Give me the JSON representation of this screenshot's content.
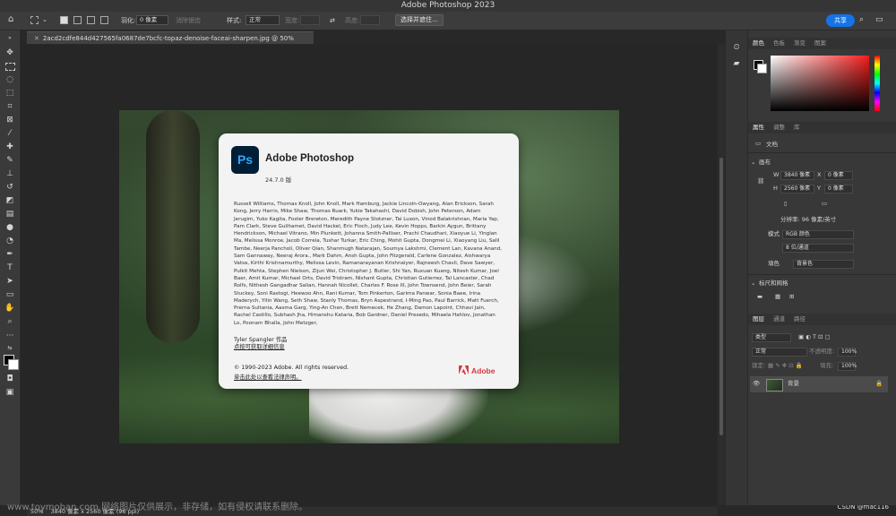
{
  "app": {
    "title": "Adobe Photoshop 2023"
  },
  "options_bar": {
    "feather_label": "羽化:",
    "feather_value": "0 像素",
    "antialias_label": "消除锯齿",
    "style_label": "样式:",
    "style_value": "正常",
    "width_label": "宽度:",
    "height_label": "高度:",
    "select_subject_label": "选择并遮住...",
    "share_label": "共享"
  },
  "document": {
    "tab_title": "2acd2cdfe844d427565fa0687de7bcfc-topaz-denoise-faceai-sharpen.jpg @ 50%(RGB/8#)",
    "zoom": "50%",
    "size_info": "3840 像素 x 2560 像素 (96 ppi)"
  },
  "about": {
    "app_name": "Adobe Photoshop",
    "logo_text": "Ps",
    "version": "24.7.0 版",
    "credits": "Russell Williams, Thomas Knoll, John Knoll, Mark Hamburg, Jackie Lincoln-Owyang, Alan Erickson, Sarah Kong, Jerry Harris, Mike Shaw, Thomas Ruark, Yukie Takahashi, David Dobish, John Peterson, Adam Jerugim, Yuko Kagita, Foster Brereton, Meredith Payne Stotzner, Tai Luxon, Vinod Balakrishnan, Maria Yap, Pam Clark, Steve Guilhamet, David Hackel, Eric Floch, Judy Lee, Kevin Hopps, Barkin Aygun, Brittany Hendrickson, Michael Vitrano, Min Plunkett, Johanna Smith-Palliser, Prachi Chaudhari, Xiaoyue Li, Yinglan Ma, Melissa Monroe, Jacob Correia, Tushar Turkar, Eric Ching, Mohit Gupta, Dongmei Li, Xiaoyang Liu, Salil Tambe, Neerja Pancholi, Oliver Qian, Shanmugh Natarajan, Soumya Lakshmi, Clement Lan, Kavana Anand, Sam Gannaway, Neeraj Arora., Mark Dahm, Ansh Gupta, John Fitzgerald, Carlene Gonzalez, Aishwarya Vatsa, Kirthi Krishnamurthy, Melissa Levin, Ramanarayanan Krishnaiyer, Rajneesh Chavli, Dave Sawyer, Pulkit Mehta, Stephen Nielson, Zijun Wei, Christopher J. Butler, Shi Yan, Ruxuan Kuang, Nitesh Kumar, Joel Baer, Amit Kumar, Michael Orts, David Tristram, Nishant Gupta, Christian Gutierrez, Tal Lancaster, Chad Rolfs, Nithesh Gangadhar Salian, Hannah Nicollet, Charles F. Rose III, John Townsend, John Beier, Sarah Stuckey, Soni Rastogi, Heewoo Ahn, Rani Kumar, Tom Pinkerton, Garima Panwar, Sonia Baee, Irina Maderych, Yilin Wang, Seth Shaw, Stanly Thomas, Bryn Aspestrand, I-Ming Pao, Paul Barrick, Matt Fuerch, Prerna Sultania, Aasma Garg, Ying-An Chen, Brett Nemecek, He Zhang, Damon Lapoint, Chhavi Jain, Rachel Castillo, Subhash Jha, Himanshu Kataria, Bob Gardner, Daniel Presedo, Mihaela Hahlov, Jonathan Lo, Poonam Bhalla, John Metzger,",
    "author": "Tyler Spangler 作品",
    "author_link": "点按可获取详细信息",
    "copyright": "© 1990-2023 Adobe. All rights reserved.",
    "legal_link": "单击此处以查看法律声明。",
    "brand": "Adobe"
  },
  "panels": {
    "color_tabs": [
      "颜色",
      "色板",
      "渐变",
      "图案"
    ],
    "props_tabs": [
      "属性",
      "调整",
      "库"
    ],
    "doc_label": "文档",
    "canvas_label": "画布",
    "w_label": "W",
    "w_value": "3840 像素",
    "h_label": "H",
    "h_value": "2560 像素",
    "x_label": "X",
    "x_placeholder": "0 像素",
    "y_label": "Y",
    "y_placeholder": "0 像素",
    "resolution": "分辨率: 96 像素/英寸",
    "mode_label": "模式",
    "mode_value": "RGB 颜色",
    "depth_value": "8 位/通道",
    "fill_label": "填色",
    "fill_value": "背景色",
    "rulers_label": "标尺和网格",
    "layers_tabs": [
      "图层",
      "通道",
      "路径"
    ],
    "kind_filter": "类型",
    "blend_mode": "正常",
    "opacity_label": "不透明度:",
    "opacity_value": "100%",
    "lock_label": "锁定:",
    "fill_pct_label": "填充:",
    "fill_pct_value": "100%",
    "layer_name": "背景"
  },
  "overlay": {
    "watermark": "www.toymoban.com 网络图片仅供展示，非存储，如有侵权请联系删除。",
    "csdn": "CSDN @mac116"
  }
}
